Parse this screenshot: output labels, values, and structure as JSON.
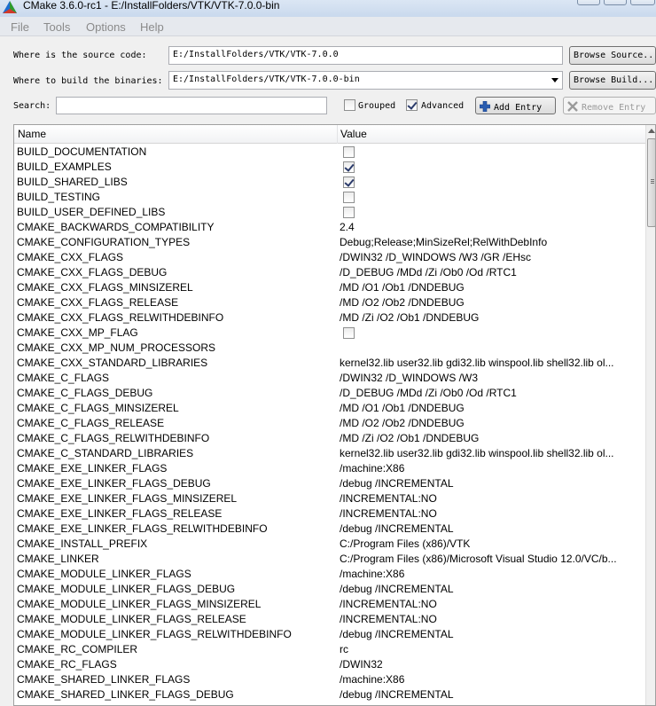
{
  "window": {
    "title": "CMake 3.6.0-rc1 - E:/InstallFolders/VTK/VTK-7.0.0-bin"
  },
  "menu": [
    {
      "label": "File"
    },
    {
      "label": "Tools"
    },
    {
      "label": "Options"
    },
    {
      "label": "Help"
    }
  ],
  "source": {
    "label": "Where is the source code:",
    "value": "E:/InstallFolders/VTK/VTK-7.0.0",
    "browse_label": "Browse Source..."
  },
  "build": {
    "label": "Where to build the binaries:",
    "value": "E:/InstallFolders/VTK/VTK-7.0.0-bin",
    "browse_label": "Browse Build..."
  },
  "search": {
    "label": "Search:",
    "value": ""
  },
  "options": {
    "grouped": {
      "label": "Grouped",
      "checked": false
    },
    "advanced": {
      "label": "Advanced",
      "checked": true
    }
  },
  "buttons": {
    "add_entry": "Add Entry",
    "remove_entry": "Remove Entry"
  },
  "table": {
    "headers": {
      "name": "Name",
      "value": "Value"
    },
    "rows": [
      {
        "name": "BUILD_DOCUMENTATION",
        "type": "bool",
        "checked": false
      },
      {
        "name": "BUILD_EXAMPLES",
        "type": "bool",
        "checked": true
      },
      {
        "name": "BUILD_SHARED_LIBS",
        "type": "bool",
        "checked": true
      },
      {
        "name": "BUILD_TESTING",
        "type": "bool",
        "checked": false
      },
      {
        "name": "BUILD_USER_DEFINED_LIBS",
        "type": "bool",
        "checked": false
      },
      {
        "name": "CMAKE_BACKWARDS_COMPATIBILITY",
        "type": "text",
        "value": "2.4"
      },
      {
        "name": "CMAKE_CONFIGURATION_TYPES",
        "type": "text",
        "value": "Debug;Release;MinSizeRel;RelWithDebInfo"
      },
      {
        "name": "CMAKE_CXX_FLAGS",
        "type": "text",
        "value": " /DWIN32 /D_WINDOWS /W3 /GR /EHsc"
      },
      {
        "name": "CMAKE_CXX_FLAGS_DEBUG",
        "type": "text",
        "value": "/D_DEBUG /MDd /Zi /Ob0 /Od /RTC1"
      },
      {
        "name": "CMAKE_CXX_FLAGS_MINSIZEREL",
        "type": "text",
        "value": "/MD /O1 /Ob1 /DNDEBUG"
      },
      {
        "name": "CMAKE_CXX_FLAGS_RELEASE",
        "type": "text",
        "value": "/MD /O2 /Ob2 /DNDEBUG"
      },
      {
        "name": "CMAKE_CXX_FLAGS_RELWITHDEBINFO",
        "type": "text",
        "value": "/MD /Zi /O2 /Ob1 /DNDEBUG"
      },
      {
        "name": "CMAKE_CXX_MP_FLAG",
        "type": "bool",
        "checked": false
      },
      {
        "name": "CMAKE_CXX_MP_NUM_PROCESSORS",
        "type": "text",
        "value": ""
      },
      {
        "name": "CMAKE_CXX_STANDARD_LIBRARIES",
        "type": "text",
        "value": "kernel32.lib user32.lib gdi32.lib winspool.lib shell32.lib ol..."
      },
      {
        "name": "CMAKE_C_FLAGS",
        "type": "text",
        "value": " /DWIN32 /D_WINDOWS /W3"
      },
      {
        "name": "CMAKE_C_FLAGS_DEBUG",
        "type": "text",
        "value": "/D_DEBUG /MDd /Zi /Ob0 /Od /RTC1"
      },
      {
        "name": "CMAKE_C_FLAGS_MINSIZEREL",
        "type": "text",
        "value": "/MD /O1 /Ob1 /DNDEBUG"
      },
      {
        "name": "CMAKE_C_FLAGS_RELEASE",
        "type": "text",
        "value": "/MD /O2 /Ob2 /DNDEBUG"
      },
      {
        "name": "CMAKE_C_FLAGS_RELWITHDEBINFO",
        "type": "text",
        "value": "/MD /Zi /O2 /Ob1 /DNDEBUG"
      },
      {
        "name": "CMAKE_C_STANDARD_LIBRARIES",
        "type": "text",
        "value": "kernel32.lib user32.lib gdi32.lib winspool.lib shell32.lib ol..."
      },
      {
        "name": "CMAKE_EXE_LINKER_FLAGS",
        "type": "text",
        "value": " /machine:X86"
      },
      {
        "name": "CMAKE_EXE_LINKER_FLAGS_DEBUG",
        "type": "text",
        "value": "/debug /INCREMENTAL"
      },
      {
        "name": "CMAKE_EXE_LINKER_FLAGS_MINSIZEREL",
        "type": "text",
        "value": "/INCREMENTAL:NO"
      },
      {
        "name": "CMAKE_EXE_LINKER_FLAGS_RELEASE",
        "type": "text",
        "value": "/INCREMENTAL:NO"
      },
      {
        "name": "CMAKE_EXE_LINKER_FLAGS_RELWITHDEBINFO",
        "type": "text",
        "value": "/debug /INCREMENTAL"
      },
      {
        "name": "CMAKE_INSTALL_PREFIX",
        "type": "text",
        "value": "C:/Program Files (x86)/VTK"
      },
      {
        "name": "CMAKE_LINKER",
        "type": "text",
        "value": "C:/Program Files (x86)/Microsoft Visual Studio 12.0/VC/b..."
      },
      {
        "name": "CMAKE_MODULE_LINKER_FLAGS",
        "type": "text",
        "value": " /machine:X86"
      },
      {
        "name": "CMAKE_MODULE_LINKER_FLAGS_DEBUG",
        "type": "text",
        "value": "/debug /INCREMENTAL"
      },
      {
        "name": "CMAKE_MODULE_LINKER_FLAGS_MINSIZEREL",
        "type": "text",
        "value": "/INCREMENTAL:NO"
      },
      {
        "name": "CMAKE_MODULE_LINKER_FLAGS_RELEASE",
        "type": "text",
        "value": "/INCREMENTAL:NO"
      },
      {
        "name": "CMAKE_MODULE_LINKER_FLAGS_RELWITHDEBINFO",
        "type": "text",
        "value": "/debug /INCREMENTAL"
      },
      {
        "name": "CMAKE_RC_COMPILER",
        "type": "text",
        "value": "rc"
      },
      {
        "name": "CMAKE_RC_FLAGS",
        "type": "text",
        "value": " /DWIN32"
      },
      {
        "name": "CMAKE_SHARED_LINKER_FLAGS",
        "type": "text",
        "value": " /machine:X86"
      },
      {
        "name": "CMAKE_SHARED_LINKER_FLAGS_DEBUG",
        "type": "text",
        "value": "/debug /INCREMENTAL"
      }
    ]
  },
  "icons": {
    "app": "cmake-triangle-icon",
    "add": "plus-icon",
    "remove": "x-icon"
  },
  "colors": {
    "add_icon": "#2a5db0",
    "remove_icon": "#9a9a9a",
    "checkmark": "#2b3b6b"
  }
}
